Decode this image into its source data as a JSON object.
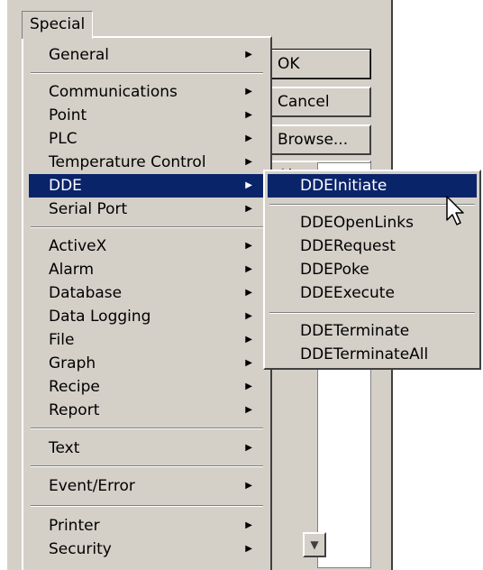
{
  "menu_bar": {
    "title": "Special"
  },
  "special_menu": {
    "items": [
      {
        "label": "General",
        "has_submenu": true
      },
      {
        "label": "Communications",
        "has_submenu": true
      },
      {
        "label": "Point",
        "has_submenu": true
      },
      {
        "label": "PLC",
        "has_submenu": true
      },
      {
        "label": "Temperature Control",
        "has_submenu": true
      },
      {
        "label": "DDE",
        "has_submenu": true,
        "highlighted": true
      },
      {
        "label": "Serial Port",
        "has_submenu": true
      },
      {
        "label": "ActiveX",
        "has_submenu": true
      },
      {
        "label": "Alarm",
        "has_submenu": true
      },
      {
        "label": "Database",
        "has_submenu": true
      },
      {
        "label": "Data Logging",
        "has_submenu": true
      },
      {
        "label": "File",
        "has_submenu": true
      },
      {
        "label": "Graph",
        "has_submenu": true
      },
      {
        "label": "Recipe",
        "has_submenu": true
      },
      {
        "label": "Report",
        "has_submenu": true
      },
      {
        "label": "Text",
        "has_submenu": true
      },
      {
        "label": "Event/Error",
        "has_submenu": true
      },
      {
        "label": "Printer",
        "has_submenu": true
      },
      {
        "label": "Security",
        "has_submenu": true
      }
    ],
    "submenu_arrow": "▶"
  },
  "dde_submenu": {
    "items": [
      {
        "label": "DDEInitiate",
        "highlighted": true
      },
      {
        "label": "DDEOpenLinks"
      },
      {
        "label": "DDERequest"
      },
      {
        "label": "DDEPoke"
      },
      {
        "label": "DDEExecute"
      },
      {
        "label": "DDETerminate"
      },
      {
        "label": "DDETerminateAll"
      }
    ]
  },
  "dialog": {
    "ok_label": "OK",
    "cancel_label": "Cancel",
    "browse_label": "Browse...",
    "partial_label": "Al",
    "scroll_down_glyph": "▼"
  },
  "colors": {
    "face": "#d4d0c8",
    "highlight": "#0a246a",
    "highlight_text": "#ffffff"
  }
}
